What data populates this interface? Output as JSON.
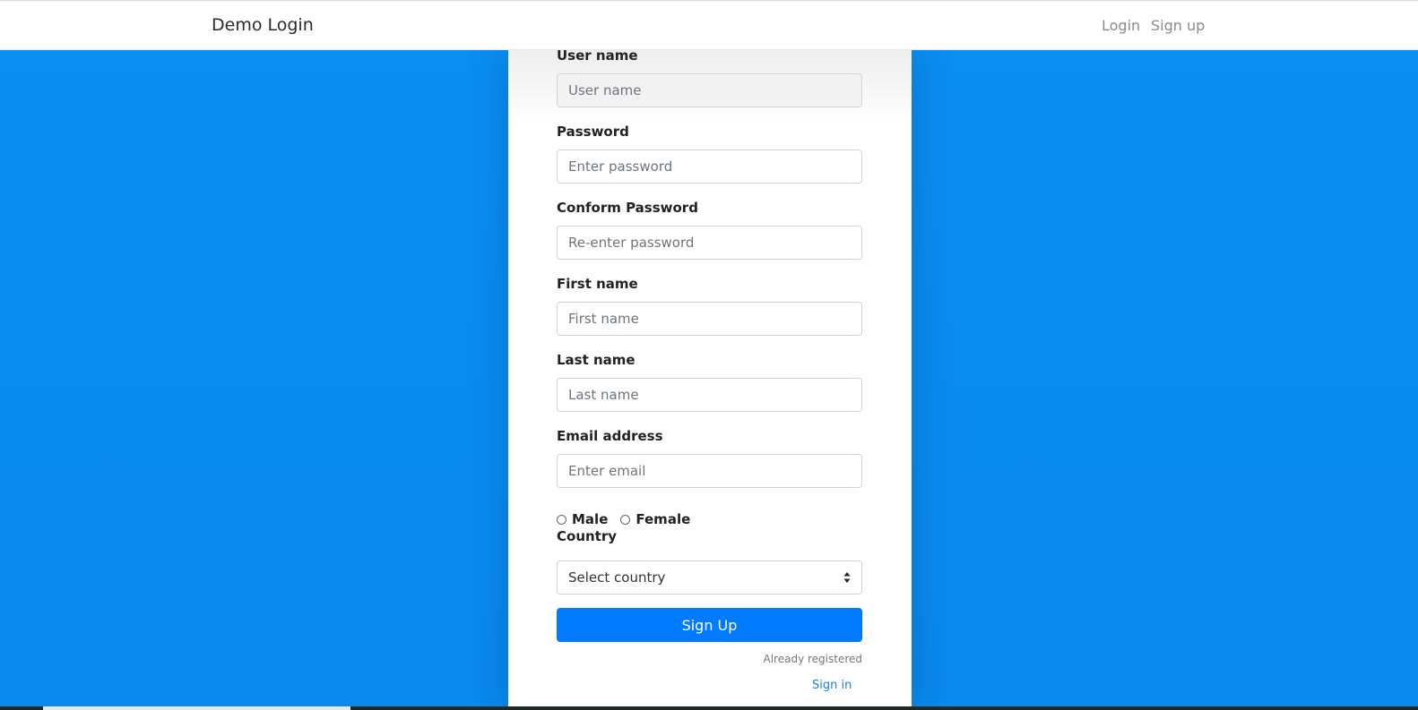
{
  "navbar": {
    "brand": "Demo Login",
    "login_label": "Login",
    "signup_label": "Sign up"
  },
  "form": {
    "username": {
      "label": "User name",
      "placeholder": "User name"
    },
    "password": {
      "label": "Password",
      "placeholder": "Enter password"
    },
    "confirm_password": {
      "label": "Conform Password",
      "placeholder": "Re-enter password"
    },
    "first_name": {
      "label": "First name",
      "placeholder": "First name"
    },
    "last_name": {
      "label": "Last name",
      "placeholder": "Last name"
    },
    "email": {
      "label": "Email address",
      "placeholder": "Enter email"
    },
    "gender": {
      "male_label": "Male",
      "female_label": "Female"
    },
    "country": {
      "label": "Country",
      "selected": "Select country"
    },
    "submit_label": "Sign Up",
    "already_registered": "Already registered",
    "signin_label": "Sign in"
  },
  "colors": {
    "background": "#0a8cf0",
    "primary_button": "#007bff",
    "link": "#1a7fe8"
  }
}
